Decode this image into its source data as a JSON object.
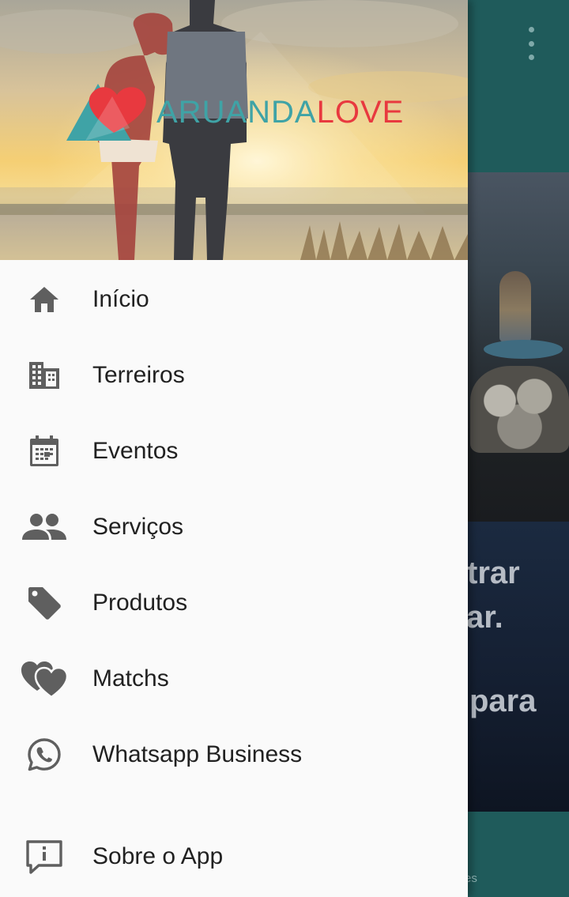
{
  "colors": {
    "toolbar": "#1f5b5b",
    "icon": "#5f5f5f",
    "label": "#212121",
    "drawer_background": "#fafafa",
    "logo_teal": "#3fa3a6",
    "logo_red": "#e8393f"
  },
  "app_bar": {
    "overflow_icon": "more-vert-icon"
  },
  "drawer": {
    "header": {
      "logo_part_1": "ARUANDA",
      "logo_part_2": "LOVE"
    },
    "items": [
      {
        "label": "Início",
        "icon": "home-icon"
      },
      {
        "label": "Terreiros",
        "icon": "building-icon"
      },
      {
        "label": "Eventos",
        "icon": "calendar-icon"
      },
      {
        "label": "Serviços",
        "icon": "people-icon"
      },
      {
        "label": "Produtos",
        "icon": "tag-icon"
      },
      {
        "label": "Matchs",
        "icon": "hearts-icon"
      },
      {
        "label": "Whatsapp Business",
        "icon": "whatsapp-icon"
      },
      {
        "label": "Sobre o App",
        "icon": "info-comment-icon"
      }
    ]
  },
  "background_content": {
    "banner_lines": [
      "trar",
      "ar.",
      "para"
    ],
    "bottom_nav_fragment": "es"
  }
}
